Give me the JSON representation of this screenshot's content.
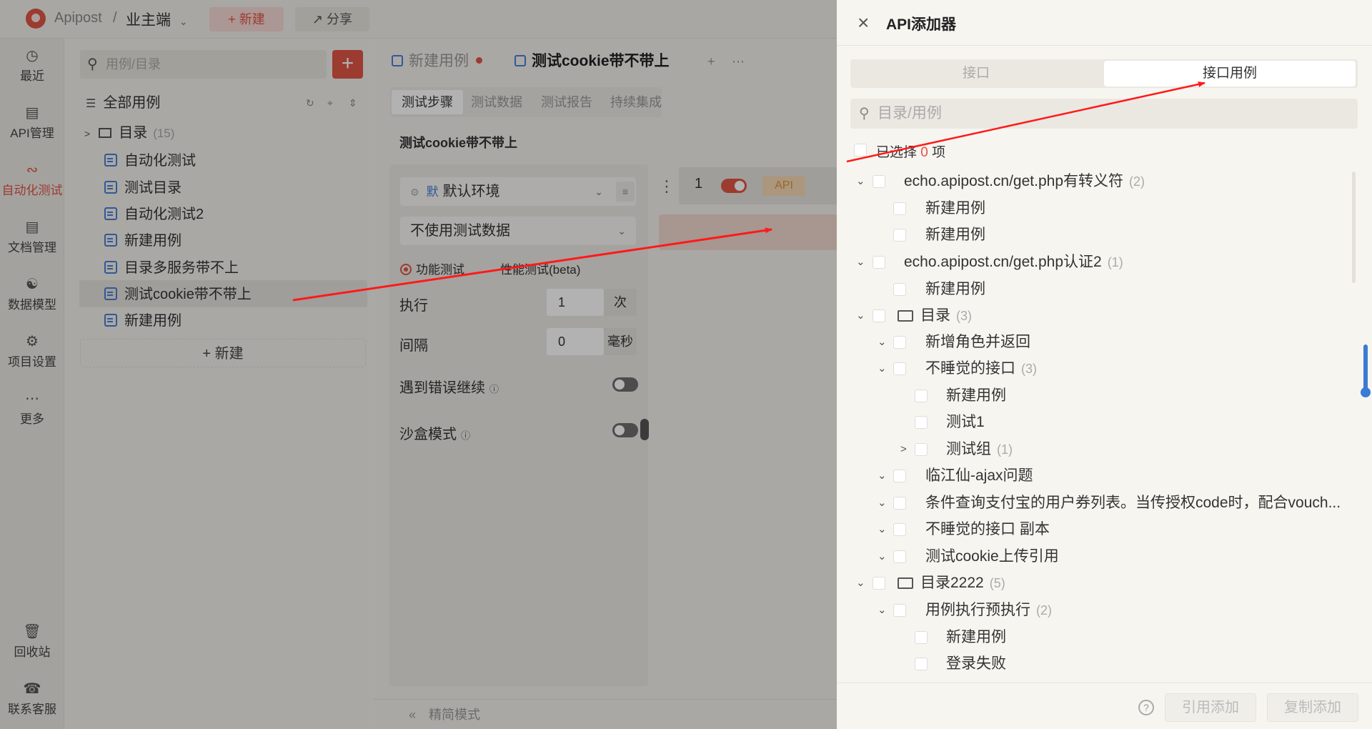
{
  "topbar": {
    "app_name": "Apipost",
    "separator": "/",
    "project": "业主端",
    "new_label": "新建",
    "share_label": "分享"
  },
  "nav": {
    "items": [
      {
        "label": "最近",
        "icon": "history-icon"
      },
      {
        "label": "API管理",
        "icon": "api-icon"
      },
      {
        "label": "自动化测试",
        "icon": "automation-icon",
        "active": true
      },
      {
        "label": "文档管理",
        "icon": "document-icon"
      },
      {
        "label": "数据模型",
        "icon": "model-icon"
      },
      {
        "label": "项目设置",
        "icon": "settings-icon"
      },
      {
        "label": "更多",
        "icon": "more-icon"
      }
    ],
    "bottom": [
      {
        "label": "回收站",
        "icon": "trash-icon"
      },
      {
        "label": "联系客服",
        "icon": "headset-icon"
      }
    ]
  },
  "cases": {
    "search_placeholder": "用例/目录",
    "all_label": "全部用例",
    "folder": {
      "label": "目录",
      "count": "(15)"
    },
    "items": [
      "自动化测试",
      "测试目录",
      "自动化测试2",
      "新建用例",
      "目录多服务带不上",
      "测试cookie带不带上",
      "新建用例"
    ],
    "new_label": "新建"
  },
  "main": {
    "tabs": [
      "新建用例",
      "测试cookie带不带上"
    ],
    "subtabs": [
      "测试步骤",
      "测试数据",
      "测试报告",
      "持续集成"
    ],
    "title": "测试cookie带不带上",
    "env_badge": "默",
    "env": "默认环境",
    "data_select": "不使用测试数据",
    "mode_functional": "功能测试",
    "mode_performance": "性能测试(beta)",
    "exec_label": "执行",
    "exec_value": "1",
    "exec_unit": "次",
    "interval_label": "间隔",
    "interval_value": "0",
    "interval_unit": "毫秒",
    "error_continue": "遇到错误继续",
    "sandbox": "沙盒模式",
    "step_index": "1",
    "step_type": "API",
    "footer": "精简模式"
  },
  "drawer": {
    "title": "API添加器",
    "seg_a": "接口",
    "seg_b": "接口用例",
    "search_placeholder": "目录/用例",
    "selected_prefix": "已选择",
    "selected_count": "0",
    "selected_suffix": "项",
    "rows": [
      {
        "label": "echo.apipost.cn/get.php有转义符",
        "count": "(2)"
      },
      {
        "label": "新建用例"
      },
      {
        "label": "新建用例"
      },
      {
        "label": "echo.apipost.cn/get.php认证2",
        "count": "(1)"
      },
      {
        "label": "新建用例"
      },
      {
        "label": "目录",
        "count": "(3)"
      },
      {
        "label": "新增角色并返回"
      },
      {
        "label": "不睡觉的接口",
        "count": "(3)"
      },
      {
        "label": "新建用例"
      },
      {
        "label": "测试1"
      },
      {
        "label": "测试组",
        "count": "(1)"
      },
      {
        "label": "临江仙-ajax问题"
      },
      {
        "label": "条件查询支付宝的用户券列表。当传授权code时，配合vouch..."
      },
      {
        "label": "不睡觉的接口 副本"
      },
      {
        "label": "测试cookie上传引用"
      },
      {
        "label": "目录2222",
        "count": "(5)"
      },
      {
        "label": "用例执行预执行",
        "count": "(2)"
      },
      {
        "label": "新建用例"
      },
      {
        "label": "登录失败"
      }
    ],
    "ref_add": "引用添加",
    "copy_add": "复制添加"
  },
  "colors": {
    "accent": "#e05545",
    "link_blue": "#4a7fd6",
    "arrow": "#ff1a1a"
  }
}
